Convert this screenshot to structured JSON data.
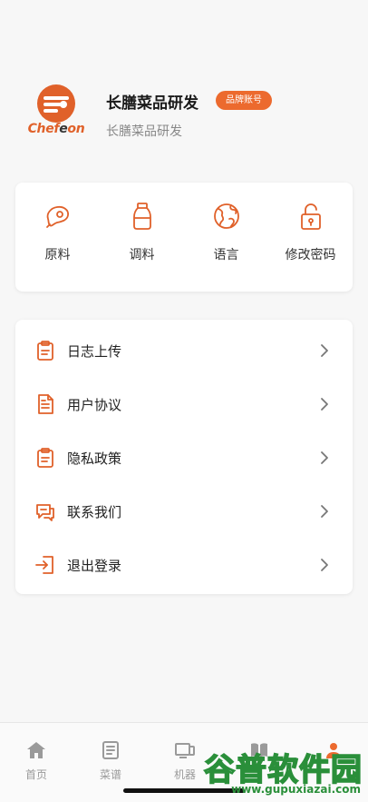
{
  "profile": {
    "logo_text_prefix": "Chef",
    "logo_text_suffix": "on",
    "logo_text_mid": "e",
    "name": "长膳菜品研发",
    "badge": "品牌账号",
    "subtitle": "长膳菜品研发"
  },
  "quick_grid": [
    {
      "label": "原料",
      "icon": "meat-icon"
    },
    {
      "label": "调料",
      "icon": "seasoning-bottle-icon"
    },
    {
      "label": "语言",
      "icon": "globe-icon"
    },
    {
      "label": "修改密码",
      "icon": "lock-icon"
    }
  ],
  "menu": [
    {
      "label": "日志上传",
      "icon": "clipboard-icon"
    },
    {
      "label": "用户协议",
      "icon": "document-icon"
    },
    {
      "label": "隐私政策",
      "icon": "clipboard-icon"
    },
    {
      "label": "联系我们",
      "icon": "chat-icon"
    },
    {
      "label": "退出登录",
      "icon": "logout-icon"
    }
  ],
  "bottom_nav": [
    {
      "label": "首页",
      "icon": "home-icon"
    },
    {
      "label": "菜谱",
      "icon": "recipe-list-icon"
    },
    {
      "label": "机器",
      "icon": "device-icon"
    },
    {
      "label": "",
      "icon": "book-icon"
    },
    {
      "label": "",
      "icon": "profile-icon"
    }
  ],
  "watermark": {
    "title": "谷普软件园",
    "url": "www.gupuxiazai.com"
  },
  "colors": {
    "accent": "#ec6a2e",
    "background": "#f7f7f7",
    "card": "#ffffff",
    "watermark_green": "#2a8f3a"
  }
}
